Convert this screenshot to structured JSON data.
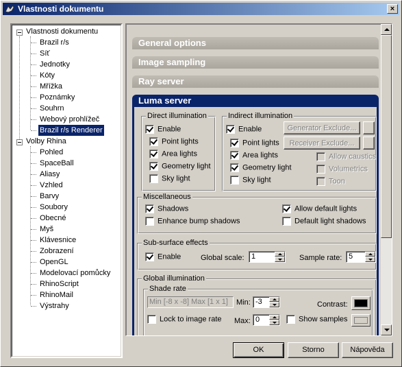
{
  "window": {
    "title": "Vlastnosti dokumentu",
    "close_glyph": "×"
  },
  "tree": {
    "groups": [
      {
        "label": "Vlastnosti dokumentu",
        "children": [
          "Brazil r/s",
          "Síť",
          "Jednotky",
          "Kóty",
          "Mřížka",
          "Poznámky",
          "Souhrn",
          "Webový prohlížeč",
          "Brazil r/s Renderer"
        ]
      },
      {
        "label": "Volby Rhina",
        "children": [
          "Pohled",
          "SpaceBall",
          "Aliasy",
          "Vzhled",
          "Barvy",
          "Soubory",
          "Obecné",
          "Myš",
          "Klávesnice",
          "Zobrazení",
          "OpenGL",
          "Modelovací pomůcky",
          "RhinoScript",
          "RhinoMail",
          "Výstrahy"
        ]
      }
    ],
    "selected": "Brazil r/s Renderer"
  },
  "rollouts": {
    "general": "General options",
    "sampling": "Image sampling",
    "ray": "Ray server",
    "luma": "Luma server"
  },
  "direct": {
    "legend": "Direct illumination",
    "enable": "Enable",
    "point": "Point lights",
    "area": "Area lights",
    "geometry": "Geometry light",
    "sky": "Sky light"
  },
  "indirect": {
    "legend": "Indirect illumination",
    "enable": "Enable",
    "point": "Point lights",
    "area": "Area lights",
    "geometry": "Geometry light",
    "sky": "Sky light",
    "gen_exclude": "Generator Exclude...",
    "rec_exclude": "Receiver Exclude...",
    "caustics": "Allow caustics",
    "volumetrics": "Volumetrics",
    "toon": "Toon"
  },
  "misc": {
    "legend": "Miscellaneous",
    "shadows": "Shadows",
    "bump": "Enhance bump shadows",
    "allow_default": "Allow default lights",
    "default_shadows": "Default light shadows"
  },
  "subsurface": {
    "legend": "Sub-surface effects",
    "enable": "Enable",
    "global_scale_label": "Global scale:",
    "global_scale": "1",
    "sample_rate_label": "Sample rate:",
    "sample_rate": "5"
  },
  "gi": {
    "legend": "Global illumination",
    "shade_legend": "Shade rate",
    "shade_value": "Min [-8 x -8] Max [1 x 1]",
    "min_label": "Min:",
    "min": "-3",
    "max_label": "Max:",
    "max": "0",
    "contrast_label": "Contrast:",
    "lock": "Lock to image rate",
    "show_samples": "Show samples"
  },
  "buttons": {
    "ok": "OK",
    "cancel": "Storno",
    "help": "Nápověda"
  }
}
